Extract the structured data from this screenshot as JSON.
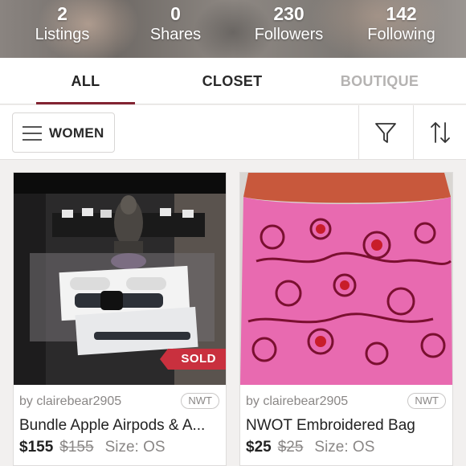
{
  "stats": [
    {
      "value": "2",
      "label": "Listings"
    },
    {
      "value": "0",
      "label": "Shares"
    },
    {
      "value": "230",
      "label": "Followers"
    },
    {
      "value": "142",
      "label": "Following"
    }
  ],
  "tabs": [
    {
      "label": "ALL",
      "active": true
    },
    {
      "label": "CLOSET",
      "active": false
    },
    {
      "label": "BOUTIQUE",
      "active": false
    }
  ],
  "filter": {
    "department": "WOMEN",
    "filter_icon": "funnel-icon",
    "sort_icon": "sort-arrows-icon"
  },
  "listings": [
    {
      "seller": "by clairebear2905",
      "badge": "NWT",
      "title": "Bundle Apple Airpods & A...",
      "price": "$155",
      "original_price": "$155",
      "size": "Size: OS",
      "status": "SOLD"
    },
    {
      "seller": "by clairebear2905",
      "badge": "NWT",
      "title": "NWOT Embroidered Bag",
      "price": "$25",
      "original_price": "$25",
      "size": "Size: OS"
    }
  ],
  "colors": {
    "accent": "#822432",
    "sold": "#c9303e"
  }
}
